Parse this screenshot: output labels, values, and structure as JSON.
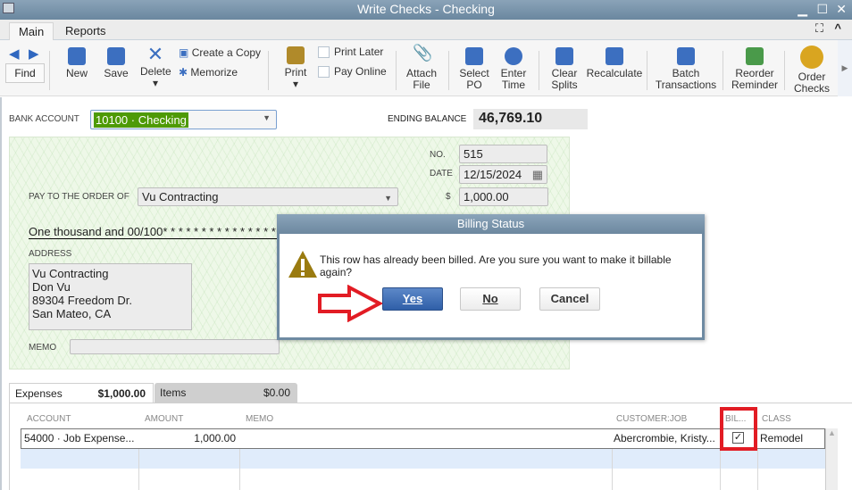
{
  "window": {
    "title": "Write Checks - Checking"
  },
  "ribbon_tabs": [
    "Main",
    "Reports"
  ],
  "toolbar": {
    "find": "Find",
    "new": "New",
    "save": "Save",
    "delete": "Delete",
    "create_copy": "Create a Copy",
    "memorize": "Memorize",
    "print": "Print",
    "print_later": "Print Later",
    "pay_online": "Pay Online",
    "attach_file": [
      "Attach",
      "File"
    ],
    "select_po": [
      "Select",
      "PO"
    ],
    "enter_time": [
      "Enter",
      "Time"
    ],
    "clear_splits": [
      "Clear",
      "Splits"
    ],
    "recalculate": "Recalculate",
    "batch": [
      "Batch",
      "Transactions"
    ],
    "reorder": [
      "Reorder",
      "Reminder"
    ],
    "order_checks": [
      "Order",
      "Checks"
    ]
  },
  "form": {
    "bank_account_label": "BANK ACCOUNT",
    "bank_account": "10100 · Checking",
    "ending_balance_label": "ENDING BALANCE",
    "ending_balance": "46,769.10",
    "no_label": "NO.",
    "no": "515",
    "date_label": "DATE",
    "date": "12/15/2024",
    "payee_label": "PAY TO THE ORDER OF",
    "payee": "Vu Contracting",
    "dollar_label": "$",
    "amount": "1,000.00",
    "amount_words": "One thousand  and 00/100* * * * * * * * * * * * * * * * * * * * *",
    "address_label": "ADDRESS",
    "address": [
      "Vu Contracting",
      "Don Vu",
      "89304 Freedom Dr.",
      "San Mateo, CA"
    ],
    "memo_label": "MEMO"
  },
  "dialog": {
    "title": "Billing Status",
    "message": "This row has already been billed. Are you sure you want to make it billable again?",
    "yes": "Yes",
    "no": "No",
    "cancel": "Cancel"
  },
  "detail_tabs": [
    {
      "label": "Expenses",
      "amount": "$1,000.00"
    },
    {
      "label": "Items",
      "amount": "$0.00"
    }
  ],
  "table": {
    "headers": [
      "ACCOUNT",
      "AMOUNT",
      "MEMO",
      "CUSTOMER:JOB",
      "BIL...",
      "CLASS"
    ],
    "rows": [
      {
        "account": "54000 · Job Expense...",
        "amount": "1,000.00",
        "memo": "",
        "customer": "Abercrombie, Kristy...",
        "billable": true,
        "class": "Remodel"
      }
    ]
  },
  "colors": {
    "highlight": "#e21c24",
    "accent": "#2f5fa8",
    "selection": "#4e9a06"
  }
}
